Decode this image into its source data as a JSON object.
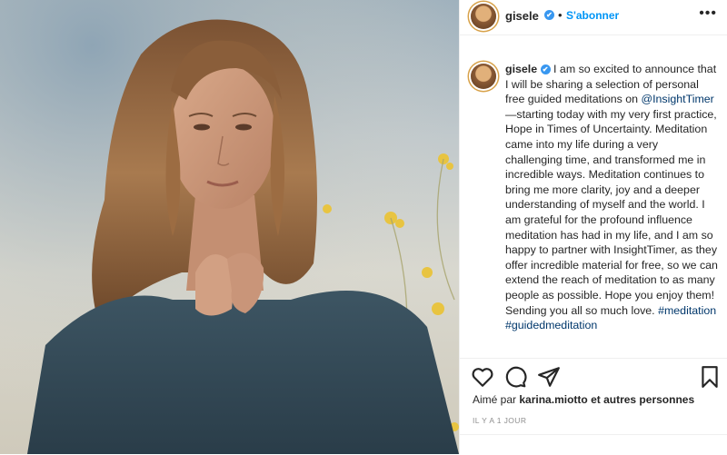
{
  "post": {
    "username": "gisele",
    "verified_glyph": "✔",
    "separator": "•",
    "follow_label": "S'abonner",
    "more_glyph": "•••"
  },
  "caption": {
    "username": "gisele",
    "part1": "I am so excited to announce that I will be sharing a selection of personal free guided meditations on",
    "mention": "@InsightTimer",
    "part2": "—starting today with my very first practice, Hope in Times of Uncertainty. Meditation came into my life during a very challenging time, and transformed me in incredible ways. Meditation continues to bring me more clarity, joy and a deeper understanding of myself and the world. I am grateful for the profound influence meditation has had in my life, and I am so happy to partner with InsightTimer, as they offer incredible material for free, so we can extend the reach of meditation to as many people as possible. Hope you enjoy them! Sending you all so much love.",
    "hashtag1": "#meditation",
    "hashtag2": "#guidedmeditation"
  },
  "likes": {
    "prefix": "Aimé par",
    "user": "karina.miotto",
    "suffix": "et autres personnes"
  },
  "timestamp": "IL Y A 1 JOUR",
  "icons": [
    "heart-icon",
    "comment-icon",
    "share-icon",
    "bookmark-icon"
  ],
  "colors": {
    "link": "#00376b",
    "follow": "#0095f6",
    "verified": "#3897f0"
  }
}
